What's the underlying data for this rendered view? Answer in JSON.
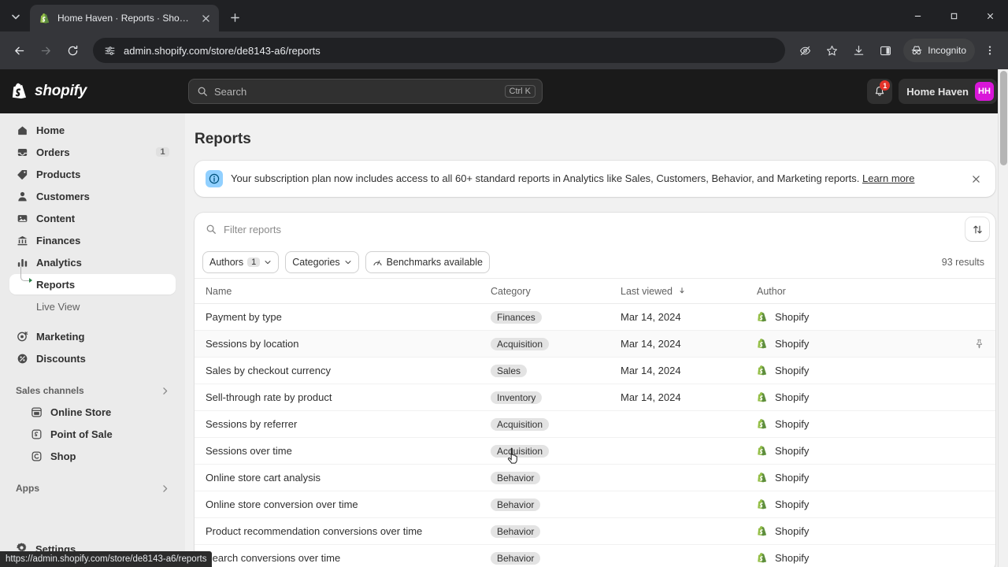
{
  "browser": {
    "tab": {
      "title": "Home Haven · Reports · Shopify",
      "favicon_icon": "shopify-bag-icon",
      "close_icon": "close-icon"
    },
    "tab_list_icon": "chevron-down-icon",
    "new_tab_icon": "plus-icon",
    "back_icon": "arrow-left-icon",
    "forward_icon": "arrow-right-icon",
    "reload_icon": "reload-icon",
    "omnibox": {
      "site_info_icon": "page-settings-icon",
      "url": "admin.shopify.com/store/de8143-a6/reports"
    },
    "toolbar_icons": [
      "eye-slash-icon",
      "star-icon",
      "download-icon",
      "side-panel-icon"
    ],
    "incognito": {
      "label": "Incognito",
      "icon": "incognito-icon"
    },
    "menu_icon": "three-dots-vertical-icon",
    "window": {
      "minimize_icon": "minimize-icon",
      "maximize_icon": "maximize-icon",
      "close_icon": "close-icon"
    },
    "status_url": "https://admin.shopify.com/store/de8143-a6/reports"
  },
  "topbar": {
    "brand": "shopify",
    "brand_icon": "shopify-bag-icon",
    "search": {
      "placeholder": "Search",
      "icon": "search-icon",
      "shortcut": "Ctrl K"
    },
    "notifications": {
      "icon": "bell-icon",
      "count": "1"
    },
    "store": {
      "name": "Home Haven",
      "initials": "HH",
      "avatar_color": "#d916d9"
    }
  },
  "sidebar": {
    "items": [
      {
        "label": "Home",
        "icon": "home-icon",
        "count": ""
      },
      {
        "label": "Orders",
        "icon": "orders-inbox-icon",
        "count": "1"
      },
      {
        "label": "Products",
        "icon": "tag-icon",
        "count": ""
      },
      {
        "label": "Customers",
        "icon": "person-icon",
        "count": ""
      },
      {
        "label": "Content",
        "icon": "image-icon",
        "count": ""
      },
      {
        "label": "Finances",
        "icon": "bank-icon",
        "count": ""
      },
      {
        "label": "Analytics",
        "icon": "bar-chart-icon",
        "count": ""
      }
    ],
    "sub_items": [
      {
        "label": "Reports",
        "active": true
      },
      {
        "label": "Live View",
        "active": false
      }
    ],
    "items_after": [
      {
        "label": "Marketing",
        "icon": "megaphone-target-icon",
        "count": ""
      },
      {
        "label": "Discounts",
        "icon": "discount-tag-icon",
        "count": ""
      }
    ],
    "sections": [
      {
        "title": "Sales channels",
        "chevron_icon": "chevron-right-icon",
        "items": [
          {
            "label": "Online Store",
            "icon": "storefront-icon"
          },
          {
            "label": "Point of Sale",
            "icon": "pos-icon"
          },
          {
            "label": "Shop",
            "icon": "shop-icon"
          }
        ]
      },
      {
        "title": "Apps",
        "chevron_icon": "chevron-right-icon",
        "items": []
      }
    ],
    "settings": {
      "label": "Settings",
      "icon": "gear-icon"
    }
  },
  "main": {
    "page_title": "Reports",
    "banner": {
      "icon": "info-circle-icon",
      "text": "Your subscription plan now includes access to all 60+ standard reports in Analytics like Sales, Customers, Behavior, and Marketing reports.",
      "link_label": "Learn more",
      "close_icon": "close-icon"
    },
    "filter": {
      "search_icon": "search-icon",
      "placeholder": "Filter reports",
      "sort_icon": "sort-arrows-icon"
    },
    "chips": [
      {
        "label": "Authors",
        "count": "1",
        "chevron_icon": "chevron-down-icon",
        "icon": ""
      },
      {
        "label": "Categories",
        "count": "",
        "chevron_icon": "chevron-down-icon",
        "icon": ""
      },
      {
        "label": "Benchmarks available",
        "count": "",
        "chevron_icon": "",
        "icon": "benchmark-icon"
      }
    ],
    "results_count": "93 results",
    "table": {
      "columns": [
        "Name",
        "Category",
        "Last viewed",
        "Author"
      ],
      "sort_indicator_icon": "sort-descending-icon",
      "author_icon": "shopify-bag-icon",
      "pin_icon": "pin-icon",
      "rows": [
        {
          "name": "Payment by type",
          "category": "Finances",
          "last_viewed": "Mar 14, 2024",
          "author": "Shopify",
          "hovered": false
        },
        {
          "name": "Sessions by location",
          "category": "Acquisition",
          "last_viewed": "Mar 14, 2024",
          "author": "Shopify",
          "hovered": true
        },
        {
          "name": "Sales by checkout currency",
          "category": "Sales",
          "last_viewed": "Mar 14, 2024",
          "author": "Shopify",
          "hovered": false
        },
        {
          "name": "Sell-through rate by product",
          "category": "Inventory",
          "last_viewed": "Mar 14, 2024",
          "author": "Shopify",
          "hovered": false
        },
        {
          "name": "Sessions by referrer",
          "category": "Acquisition",
          "last_viewed": "",
          "author": "Shopify",
          "hovered": false
        },
        {
          "name": "Sessions over time",
          "category": "Acquisition",
          "last_viewed": "",
          "author": "Shopify",
          "hovered": false
        },
        {
          "name": "Online store cart analysis",
          "category": "Behavior",
          "last_viewed": "",
          "author": "Shopify",
          "hovered": false
        },
        {
          "name": "Online store conversion over time",
          "category": "Behavior",
          "last_viewed": "",
          "author": "Shopify",
          "hovered": false
        },
        {
          "name": "Product recommendation conversions over time",
          "category": "Behavior",
          "last_viewed": "",
          "author": "Shopify",
          "hovered": false
        },
        {
          "name": "Search conversions over time",
          "category": "Behavior",
          "last_viewed": "",
          "author": "Shopify",
          "hovered": false
        }
      ]
    }
  }
}
